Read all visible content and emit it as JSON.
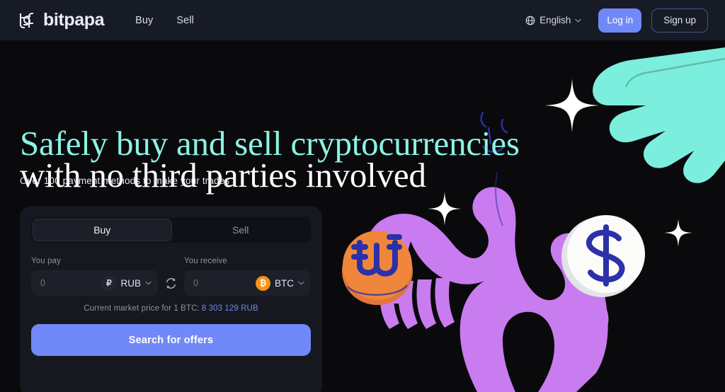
{
  "header": {
    "brand": "bitpapa",
    "brand_icon": "bitpapa-logo-icon",
    "nav": [
      {
        "label": "Buy"
      },
      {
        "label": "Sell"
      }
    ],
    "language": {
      "icon": "globe-icon",
      "label": "English",
      "chevron": "chevron-down-icon"
    },
    "login_label": "Log in",
    "signup_label": "Sign up"
  },
  "hero": {
    "headline_line1": "Safely buy and sell cryptocurrencies",
    "headline_line2": "with no third parties involved",
    "headline_line1_color": "#8df2e4",
    "headline_line2_color": "#ffffff",
    "subhead": "Over 100 payment methods to make your trades"
  },
  "exchange_card": {
    "tabs": [
      {
        "label": "Buy",
        "active": true
      },
      {
        "label": "Sell",
        "active": false
      }
    ],
    "pay": {
      "label": "You pay",
      "value": "",
      "placeholder": "0",
      "currency_code": "RUB",
      "currency_symbol": "₽",
      "currency_icon": "ruble-coin-icon",
      "chevron": "chevron-down-icon"
    },
    "swap_icon": "swap-arrows-icon",
    "receive": {
      "label": "You receive",
      "value": "",
      "placeholder": "0",
      "currency_code": "BTC",
      "currency_symbol": "₿",
      "currency_icon": "bitcoin-coin-icon",
      "chevron": "chevron-down-icon"
    },
    "market_note": "Current market price for 1 BTC:",
    "market_price": "8 303 129 RUB",
    "market_price_color": "#6f87f7",
    "submit_label": "Search for offers",
    "submit_color": "#7189f8"
  },
  "illustration": {
    "name": "crypto-exchange-hands-illustration",
    "elements": [
      "purple-creature-arm",
      "mint-hand",
      "dollar-coin",
      "bitcoin-coin",
      "sparkle-star-large",
      "sparkle-star-medium",
      "sparkle-star-small"
    ],
    "colors": {
      "purple": "#c97bf0",
      "mint": "#7ceede",
      "coin_white": "#fbfbfa",
      "coin_orange": "#f0863c",
      "deep_blue": "#2b31a8",
      "background": "#0a0a0c"
    }
  }
}
